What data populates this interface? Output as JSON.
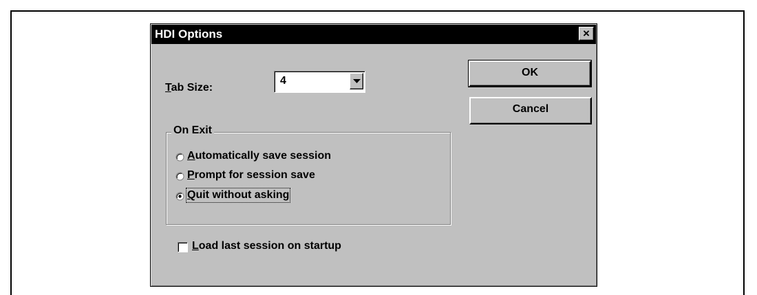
{
  "dialog": {
    "title": "HDI Options",
    "close_icon": "close-icon"
  },
  "tab_size": {
    "label_accel": "T",
    "label_rest": "ab Size:",
    "value": "4",
    "dropdown_icon": "chevron-down-icon"
  },
  "buttons": {
    "ok": "OK",
    "cancel": "Cancel"
  },
  "on_exit": {
    "label": "On Exit",
    "options": [
      {
        "accel": "A",
        "rest": "utomatically save session",
        "selected": false
      },
      {
        "accel": "P",
        "rest": "rompt for session save",
        "selected": false
      },
      {
        "accel": "Q",
        "rest": "uit without asking",
        "selected": true
      }
    ]
  },
  "load_last": {
    "accel": "L",
    "rest": "oad last session on startup",
    "checked": false
  }
}
